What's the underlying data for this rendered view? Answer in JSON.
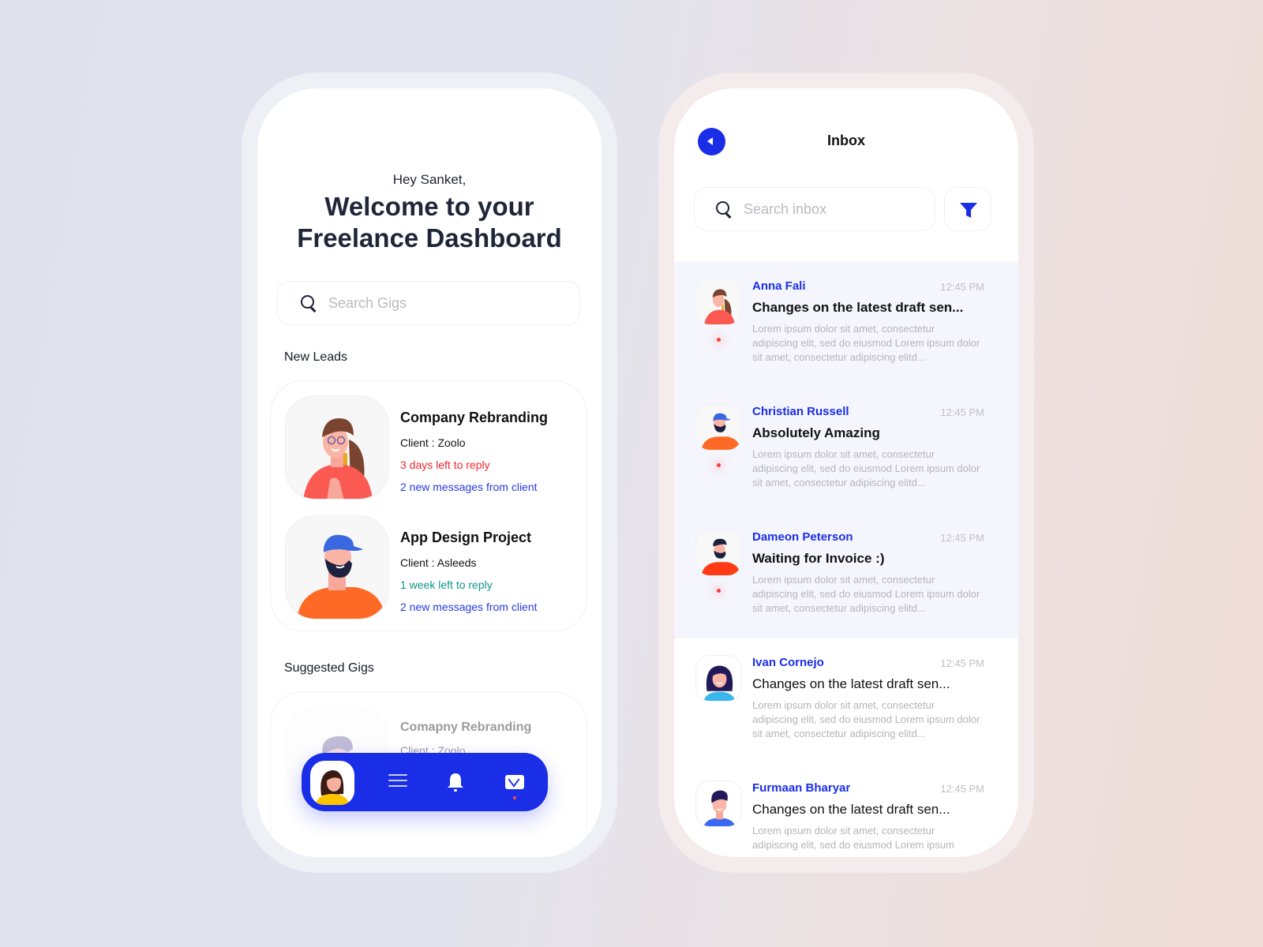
{
  "dashboard": {
    "greeting": "Hey Sanket,",
    "welcome_line1": "Welcome to your",
    "welcome_line2": "Freelance Dashboard",
    "search": {
      "placeholder": "Search Gigs",
      "value": ""
    },
    "new_leads_label": "New Leads",
    "leads": [
      {
        "title": "Company Rebranding",
        "client": "Client : Zoolo",
        "deadline": "3 days left to reply",
        "deadline_color": "#f0262c",
        "messages": "2 new messages from client",
        "avatar": "woman-ponytail-glasses-avatar"
      },
      {
        "title": "App Design Project",
        "client": "Client : Asleeds",
        "deadline": "1 week left to reply",
        "deadline_color": "#109587",
        "messages": "2 new messages from client",
        "avatar": "bearded-man-cap-avatar"
      }
    ],
    "suggested_label": "Suggested Gigs",
    "suggested": [
      {
        "title": "Comapny Rebranding",
        "client": "Client : Zoolo",
        "avatar": "man-quiff-avatar"
      }
    ],
    "bottom_nav": {
      "items": [
        "profile",
        "menu",
        "notifications",
        "inbox"
      ],
      "active": "inbox",
      "inbox_has_unread": true
    }
  },
  "inbox": {
    "title": "Inbox",
    "search": {
      "placeholder": "Search inbox",
      "value": ""
    },
    "messages": [
      {
        "name": "Anna Fali",
        "time": "12:45 PM",
        "subject": "Changes on the latest draft sen...",
        "preview": "Lorem ipsum dolor sit amet, consectetur adipiscing elit, sed do eiusmod Lorem ipsum dolor sit amet, consectetur adipiscing elitd...",
        "unread": true
      },
      {
        "name": "Christian Russell",
        "time": "12:45 PM",
        "subject": "Absolutely Amazing",
        "preview": "Lorem ipsum dolor sit amet, consectetur adipiscing elit, sed do eiusmod Lorem ipsum dolor sit amet, consectetur adipiscing elitd...",
        "unread": true
      },
      {
        "name": "Dameon Peterson",
        "time": "12:45 PM",
        "subject": "Waiting for Invoice :)",
        "preview": "Lorem ipsum dolor sit amet, consectetur adipiscing elit, sed do eiusmod Lorem ipsum dolor sit amet, consectetur adipiscing elitd...",
        "unread": true
      },
      {
        "name": "Ivan Cornejo",
        "time": "12:45 PM",
        "subject": "Changes on the latest draft sen...",
        "preview": "Lorem ipsum dolor sit amet, consectetur adipiscing elit, sed do eiusmod Lorem ipsum dolor sit amet, consectetur adipiscing elitd...",
        "unread": false
      },
      {
        "name": "Furmaan Bharyar",
        "time": "12:45 PM",
        "subject": "Changes on the latest draft sen...",
        "preview": "Lorem ipsum dolor sit amet, consectetur adipiscing elit, sed do eiusmod Lorem ipsum",
        "unread": false
      }
    ]
  },
  "colors": {
    "accent": "#1a2ee8",
    "unread_dot": "#ff3a3a",
    "urgent": "#f0262c",
    "relaxed": "#109587"
  }
}
